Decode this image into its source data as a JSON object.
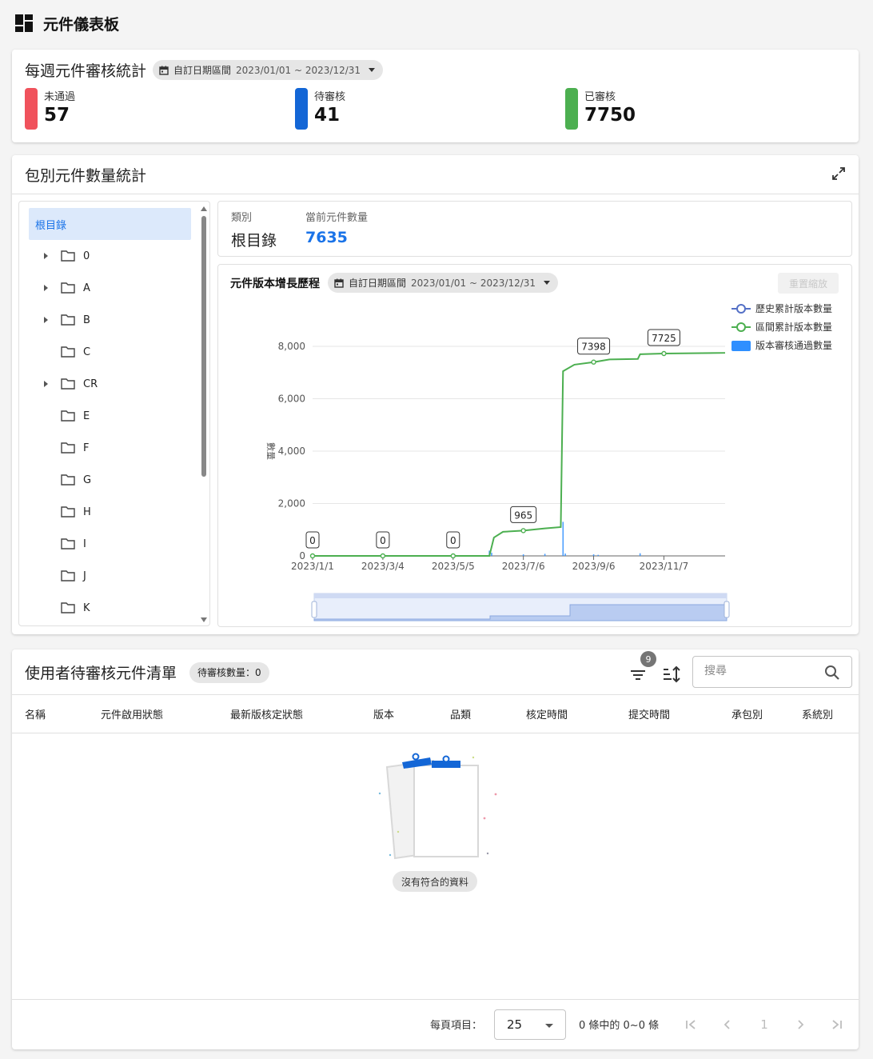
{
  "page": {
    "title": "元件儀表板"
  },
  "weekly": {
    "title": "每週元件審核統計",
    "range_label": "自訂日期區間",
    "range_value": "2023/01/01 ~ 2023/12/31",
    "stats": [
      {
        "label": "未通過",
        "value": "57",
        "color": "#f0525c"
      },
      {
        "label": "待審核",
        "value": "41",
        "color": "#1366d6"
      },
      {
        "label": "已審核",
        "value": "7750",
        "color": "#4caf50"
      }
    ]
  },
  "package": {
    "title": "包別元件數量統計",
    "tree": {
      "root": "根目錄",
      "items": [
        {
          "name": "0",
          "expandable": true
        },
        {
          "name": "A",
          "expandable": true
        },
        {
          "name": "B",
          "expandable": true
        },
        {
          "name": "C",
          "expandable": false
        },
        {
          "name": "CR",
          "expandable": true
        },
        {
          "name": "E",
          "expandable": false
        },
        {
          "name": "F",
          "expandable": false
        },
        {
          "name": "G",
          "expandable": false
        },
        {
          "name": "H",
          "expandable": false
        },
        {
          "name": "I",
          "expandable": false
        },
        {
          "name": "J",
          "expandable": false
        },
        {
          "name": "K",
          "expandable": false
        }
      ]
    },
    "info": {
      "category_label": "類別",
      "category_value": "根目錄",
      "count_label": "當前元件數量",
      "count_value": "7635"
    },
    "chart": {
      "title": "元件版本增長歷程",
      "range_label": "自訂日期區間",
      "range_value": "2023/01/01 ~ 2023/12/31",
      "reset_label": "重置縮放"
    }
  },
  "chart_data": {
    "type": "line",
    "ylabel": "數量",
    "ylim": [
      0,
      8000
    ],
    "yticks": [
      "0",
      "2,000",
      "4,000",
      "6,000",
      "8,000"
    ],
    "xticks": [
      "2023/1/1",
      "2023/3/4",
      "2023/5/5",
      "2023/7/6",
      "2023/9/6",
      "2023/11/7"
    ],
    "legend_position": "top-right",
    "series": [
      {
        "name": "歷史累計版本數量",
        "color": "#5470c6",
        "marker": "circle"
      },
      {
        "name": "區間累計版本數量",
        "color": "#4caf50",
        "marker": "circle",
        "points": [
          [
            "2023/1/1",
            0
          ],
          [
            "2023/3/4",
            0
          ],
          [
            "2023/5/5",
            0
          ],
          [
            "2023/6/6",
            0
          ],
          [
            "2023/6/10",
            700
          ],
          [
            "2023/6/18",
            920
          ],
          [
            "2023/7/6",
            965
          ],
          [
            "2023/7/25",
            1050
          ],
          [
            "2023/8/8",
            1100
          ],
          [
            "2023/8/10",
            7050
          ],
          [
            "2023/8/20",
            7300
          ],
          [
            "2023/9/6",
            7398
          ],
          [
            "2023/9/20",
            7500
          ],
          [
            "2023/10/15",
            7520
          ],
          [
            "2023/10/17",
            7700
          ],
          [
            "2023/11/7",
            7725
          ],
          [
            "2023/12/31",
            7750
          ]
        ],
        "labels": [
          {
            "x": "2023/1/1",
            "text": "0"
          },
          {
            "x": "2023/3/4",
            "text": "0"
          },
          {
            "x": "2023/5/5",
            "text": "0"
          },
          {
            "x": "2023/7/6",
            "text": "965"
          },
          {
            "x": "2023/9/6",
            "text": "7398"
          },
          {
            "x": "2023/11/7",
            "text": "7725"
          }
        ]
      },
      {
        "name": "版本審核通過數量",
        "color": "#2f8fff",
        "marker": "rect",
        "bars": [
          [
            "2023/6/6",
            200
          ],
          [
            "2023/6/8",
            120
          ],
          [
            "2023/7/6",
            60
          ],
          [
            "2023/7/25",
            80
          ],
          [
            "2023/8/10",
            1300
          ],
          [
            "2023/8/12",
            90
          ],
          [
            "2023/9/6",
            60
          ],
          [
            "2023/9/10",
            40
          ],
          [
            "2023/10/17",
            100
          ]
        ]
      }
    ]
  },
  "pending": {
    "title": "使用者待審核元件清單",
    "count_chip": "待審核數量：0",
    "filter_badge": "9",
    "search_placeholder": "搜尋",
    "columns": [
      "名稱",
      "元件啟用狀態",
      "最新版核定狀態",
      "版本",
      "品類",
      "核定時間",
      "提交時間",
      "承包別",
      "系統別"
    ],
    "empty_text": "沒有符合的資料",
    "per_page_label": "每頁項目：",
    "per_page_value": "25",
    "range_text": "0 條中的 0~0 條",
    "current_page": "1"
  }
}
